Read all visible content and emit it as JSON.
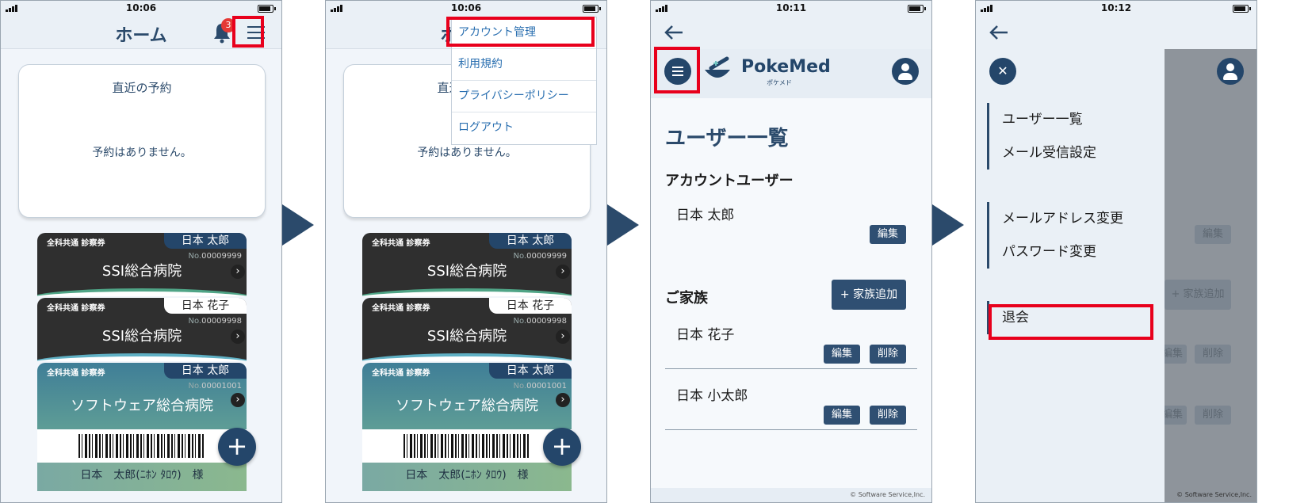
{
  "status": {
    "time1": "10:06",
    "time2": "10:06",
    "time3": "10:11",
    "time4": "10:12"
  },
  "home": {
    "title": "ホーム",
    "badge": "3",
    "reserve_title": "直近の予約",
    "reserve_empty": "予約はありません。",
    "cards": [
      {
        "type": "全科共通 診察券",
        "name": "日本 太郎",
        "no_prefix": "No.",
        "no": "00009999",
        "hospital": "SSI総合病院"
      },
      {
        "type": "全科共通 診察券",
        "name": "日本 花子",
        "no_prefix": "No.",
        "no": "00009998",
        "hospital": "SSI総合病院"
      },
      {
        "type": "全科共通 診察券",
        "name": "日本 太郎",
        "no_prefix": "No.",
        "no": "00001001",
        "hospital": "ソフトウェア総合病院"
      }
    ],
    "patient_line": "日本　太郎(ﾆﾎﾝ ﾀﾛｳ)　様",
    "fab": "+"
  },
  "dropdown": {
    "items": [
      "アカウント管理",
      "利用規約",
      "プライバシーポリシー",
      "ログアウト"
    ]
  },
  "users": {
    "logo": "PokeMed",
    "logo_sub": "ポケメド",
    "heading": "ユーザー一覧",
    "account_section": "アカウントユーザー",
    "account_user": "日本 太郎",
    "edit": "編集",
    "delete": "削除",
    "family_section": "ご家族",
    "add_family": "+ 家族追加",
    "family": [
      "日本 花子",
      "日本 小太郎"
    ],
    "copyright": "© Software Service,Inc."
  },
  "drawer": {
    "group1": [
      "ユーザー一覧",
      "メール受信設定"
    ],
    "group2": [
      "メールアドレス変更",
      "パスワード変更"
    ],
    "withdraw": "退会"
  },
  "colors": {
    "navy": "#24466a",
    "highlight": "#e8001c",
    "link": "#2a6fb0"
  }
}
